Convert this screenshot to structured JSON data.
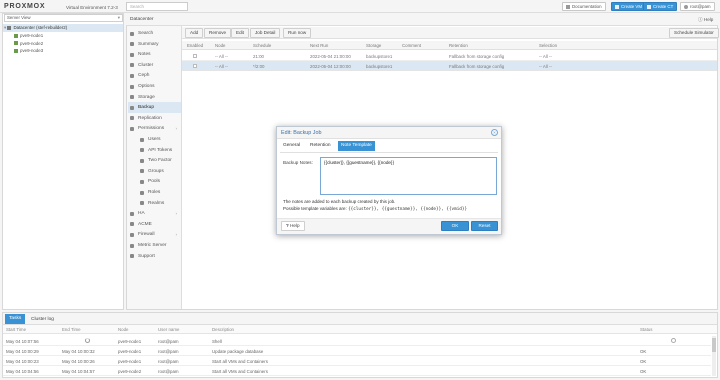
{
  "header": {
    "logo_text": "PROXMOX",
    "product": "Virtual Environment 7.2-3",
    "search_placeholder": "Search",
    "buttons": [
      "Documentation",
      "Create VM",
      "Create CT",
      "root@pam"
    ]
  },
  "tree": {
    "view_label": "Server View",
    "datacenter": "Datacenter (stef-rebuilder2)",
    "nodes": [
      "pve9-node1",
      "pve9-node2",
      "pve9-node3"
    ]
  },
  "content": {
    "breadcrumb": "Datacenter",
    "help": "Help"
  },
  "nav": {
    "items": [
      {
        "label": "Search",
        "sub": false
      },
      {
        "label": "Summary",
        "sub": false
      },
      {
        "label": "Notes",
        "sub": false
      },
      {
        "label": "Cluster",
        "sub": false
      },
      {
        "label": "Ceph",
        "sub": false
      },
      {
        "label": "Options",
        "sub": false
      },
      {
        "label": "Storage",
        "sub": false
      },
      {
        "label": "Backup",
        "sub": false,
        "active": true
      },
      {
        "label": "Replication",
        "sub": false
      },
      {
        "label": "Permissions",
        "sub": false,
        "caret": true
      },
      {
        "label": "Users",
        "sub": true
      },
      {
        "label": "API Tokens",
        "sub": true
      },
      {
        "label": "Two Factor",
        "sub": true
      },
      {
        "label": "Groups",
        "sub": true
      },
      {
        "label": "Pools",
        "sub": true
      },
      {
        "label": "Roles",
        "sub": true
      },
      {
        "label": "Realms",
        "sub": true
      },
      {
        "label": "HA",
        "sub": false,
        "caret": true
      },
      {
        "label": "ACME",
        "sub": false
      },
      {
        "label": "Firewall",
        "sub": false,
        "caret": true
      },
      {
        "label": "Metric Server",
        "sub": false
      },
      {
        "label": "Support",
        "sub": false
      }
    ]
  },
  "toolbar": {
    "add": "Add",
    "remove": "Remove",
    "edit": "Edit",
    "job_detail": "Job Detail",
    "run_now": "Run now",
    "schedule_simulator": "Schedule Simulator"
  },
  "backup_table": {
    "columns": [
      "Enabled",
      "Node",
      "Schedule",
      "Next Run",
      "Storage",
      "Comment",
      "Retention",
      "Selection"
    ],
    "rows": [
      {
        "enabled": "",
        "node": "-- All --",
        "schedule": "21:00",
        "next_run": "2022-05-04 21:00:00",
        "storage": "backupstore1",
        "comment": "",
        "retention": "Fallback from storage config",
        "selection": "-- All --"
      },
      {
        "enabled": "",
        "node": "-- All --",
        "schedule": "*/2:00",
        "next_run": "2022-05-04 12:00:00",
        "storage": "backupstore1",
        "comment": "",
        "retention": "Fallback from storage config",
        "selection": "-- All --"
      }
    ]
  },
  "dialog": {
    "title": "Edit: Backup Job",
    "tabs": [
      "General",
      "Retention",
      "Note Template"
    ],
    "field_label": "Backup Notes:",
    "field_value": "{{cluster}}, {{guestname}}, {{node}}",
    "hint_line1": "The notes are added to each backup created by this job.",
    "hint_line2_prefix": "Possible template variables are:",
    "hint_vars": "{{cluster}}, {{guestname}}, {{node}}, {{vmid}}",
    "help": "Help",
    "ok": "OK",
    "reset": "Reset"
  },
  "log": {
    "tabs": [
      "Tasks",
      "Cluster log"
    ],
    "columns": [
      "Start Time",
      "End Time",
      "Node",
      "User name",
      "Description",
      "Status"
    ],
    "rows": [
      {
        "start": "May 04 10:07:56",
        "end": "",
        "node": "pve9-node1",
        "user": "root@pam",
        "desc": "Shell",
        "status": ""
      },
      {
        "start": "May 04 10:00:29",
        "end": "May 04 10:00:32",
        "node": "pve9-node1",
        "user": "root@pam",
        "desc": "Update package database",
        "status": "OK"
      },
      {
        "start": "May 04 10:00:23",
        "end": "May 04 10:00:26",
        "node": "pve9-node1",
        "user": "root@pam",
        "desc": "Start all VMs and Containers",
        "status": "OK"
      },
      {
        "start": "May 04 10:04:56",
        "end": "May 04 10:04:57",
        "node": "pve9-node2",
        "user": "root@pam",
        "desc": "Start all VMs and Containers",
        "status": "OK"
      }
    ]
  },
  "colors": {
    "accent": "#3892d4",
    "selected_row": "#dbe8f4",
    "tree_icon": "#6a9a4a"
  }
}
